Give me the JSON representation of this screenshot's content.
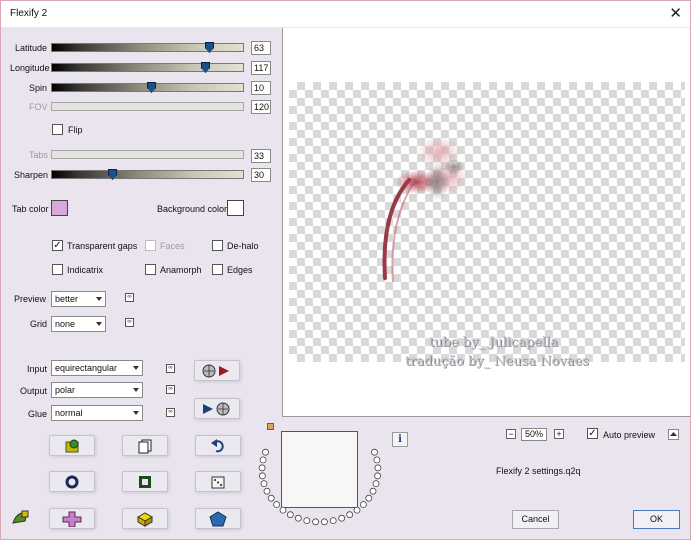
{
  "window": {
    "title": "Flexify 2",
    "close_glyph": "✕"
  },
  "sliders": [
    {
      "key": "latitude",
      "label": "Latitude",
      "value": "63",
      "fraction": 0.84,
      "enabled": true
    },
    {
      "key": "longitude",
      "label": "Longitude",
      "value": "117",
      "fraction": 0.82,
      "enabled": true
    },
    {
      "key": "spin",
      "label": "Spin",
      "value": "10",
      "fraction": 0.52,
      "enabled": true
    },
    {
      "key": "fov",
      "label": "FOV",
      "value": "120",
      "fraction": null,
      "enabled": false
    },
    {
      "key": "tabs",
      "label": "Tabs",
      "value": "33",
      "fraction": null,
      "enabled": false
    },
    {
      "key": "sharpen",
      "label": "Sharpen",
      "value": "30",
      "fraction": 0.31,
      "enabled": true
    }
  ],
  "flip": {
    "label": "Flip",
    "checked": false
  },
  "tab_color": {
    "label": "Tab color",
    "color": "#d6a9d8"
  },
  "background_color": {
    "label": "Background color",
    "color": "#ffffff"
  },
  "options": {
    "transparent_gaps": {
      "label": "Transparent gaps",
      "checked": true
    },
    "faces": {
      "label": "Faces",
      "checked": false
    },
    "de_halo": {
      "label": "De-halo",
      "checked": false
    },
    "indicatrix": {
      "label": "Indicatrix",
      "checked": false
    },
    "anamorph": {
      "label": "Anamorph",
      "checked": false
    },
    "edges": {
      "label": "Edges",
      "checked": false
    }
  },
  "preview_quality": {
    "label": "Preview",
    "value": "better"
  },
  "grid": {
    "label": "Grid",
    "value": "none"
  },
  "lock_glyph": "∞",
  "projection": {
    "input": {
      "label": "Input",
      "value": "equirectangular"
    },
    "output": {
      "label": "Output",
      "value": "polar"
    },
    "glue": {
      "label": "Glue",
      "value": "normal"
    }
  },
  "watermark": {
    "line1": "tube by_ Julicapella",
    "line2": "tradução by_ Neusa Novaes"
  },
  "zoom": {
    "minus": "−",
    "value": "50%",
    "plus": "+"
  },
  "auto_preview": {
    "label": "Auto preview",
    "checked": true
  },
  "info_glyph": "i",
  "settings_file": "Flexify 2 settings.q2q",
  "buttons": {
    "cancel": "Cancel",
    "ok": "OK"
  },
  "colors": {
    "accent_blue": "#1f4f8a",
    "window_bg": "#e9e4ee"
  }
}
